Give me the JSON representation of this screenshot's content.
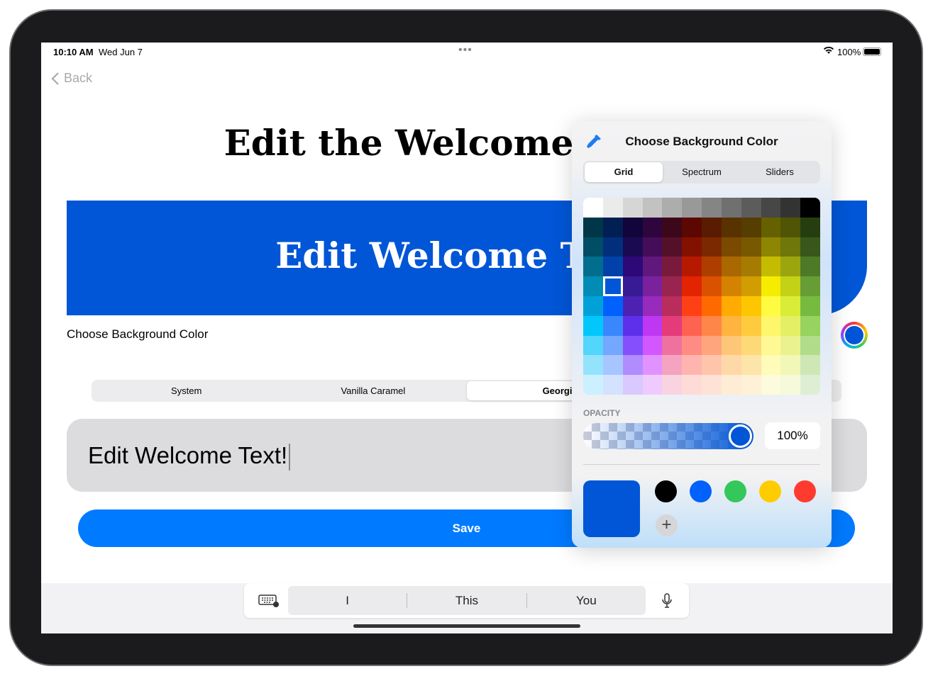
{
  "status": {
    "time": "10:10 AM",
    "date": "Wed Jun 7",
    "battery": "100%"
  },
  "nav": {
    "back": "Back"
  },
  "title": "Edit the Welcome",
  "banner": {
    "text": "Edit Welcome Text!",
    "color": "#0056d6"
  },
  "bg_label": "Choose Background Color",
  "fonts": {
    "options": [
      "System",
      "Vanilla Caramel",
      "Georgia",
      ""
    ],
    "selected": "Georgia"
  },
  "field": {
    "value": "Edit Welcome Text!"
  },
  "save": "Save",
  "keyboard": {
    "suggestions": [
      "I",
      "This",
      "You"
    ]
  },
  "picker": {
    "title": "Choose Background Color",
    "tabs": [
      "Grid",
      "Spectrum",
      "Sliders"
    ],
    "selected_tab": "Grid",
    "grid": [
      [
        "#ffffff",
        "#ebebeb",
        "#d6d6d6",
        "#c2c2c2",
        "#adadad",
        "#999999",
        "#858585",
        "#707070",
        "#5c5c5c",
        "#474747",
        "#333333",
        "#000000"
      ],
      [
        "#003748",
        "#021f54",
        "#11053b",
        "#2e063d",
        "#3c071b",
        "#5c0701",
        "#5a1c00",
        "#583300",
        "#563d00",
        "#666100",
        "#4f5504",
        "#263e0f"
      ],
      [
        "#004d65",
        "#012f7b",
        "#1a0a52",
        "#450d59",
        "#551029",
        "#831100",
        "#7b2900",
        "#7a4a00",
        "#785800",
        "#8d8602",
        "#6f760a",
        "#38571a"
      ],
      [
        "#016e8f",
        "#0042a9",
        "#2c0977",
        "#61187c",
        "#791a3d",
        "#b51a00",
        "#ad3e00",
        "#a96800",
        "#a67b01",
        "#c4bc00",
        "#9ba50e",
        "#4e7a27"
      ],
      [
        "#008cb4",
        "#0056d6",
        "#371a94",
        "#7a219e",
        "#99244f",
        "#e22400",
        "#da5100",
        "#d38301",
        "#d19d01",
        "#f5ec00",
        "#c3d117",
        "#669d34"
      ],
      [
        "#00a1d8",
        "#0061fd",
        "#4d22b2",
        "#982abc",
        "#b92d5d",
        "#ff4015",
        "#ff6a00",
        "#ffab01",
        "#fcc700",
        "#fefb41",
        "#d9ec37",
        "#76bb40"
      ],
      [
        "#01c7fc",
        "#3a87fd",
        "#5e30eb",
        "#be38f3",
        "#e63b7a",
        "#fe6250",
        "#fe8648",
        "#feb43f",
        "#fecb3e",
        "#fff76b",
        "#e4ef65",
        "#96d35f"
      ],
      [
        "#52d6fc",
        "#74a7ff",
        "#864ffd",
        "#d357fe",
        "#ee719e",
        "#ff8c82",
        "#fea57d",
        "#fec777",
        "#fed977",
        "#fff994",
        "#eaf28f",
        "#b1dd8b"
      ],
      [
        "#93e3fc",
        "#a7c6ff",
        "#b18cfe",
        "#e292fe",
        "#f4a4c0",
        "#ffb5af",
        "#ffc5ab",
        "#fed9a8",
        "#fde4a8",
        "#fffbb9",
        "#f1f7b7",
        "#cde8b5"
      ],
      [
        "#cbf0ff",
        "#d3e2ff",
        "#d9c9fe",
        "#efcaff",
        "#f9d3e0",
        "#ffdbd8",
        "#ffe2d6",
        "#feecd4",
        "#fef1d5",
        "#fdfbdd",
        "#f6fadb",
        "#deeed4"
      ]
    ],
    "selected_color": "#0056d6",
    "opacity_label": "OPACITY",
    "opacity": "100%",
    "swatches": [
      "#000000",
      "#0061fd",
      "#34c759",
      "#ffcc00",
      "#ff3b30"
    ]
  }
}
